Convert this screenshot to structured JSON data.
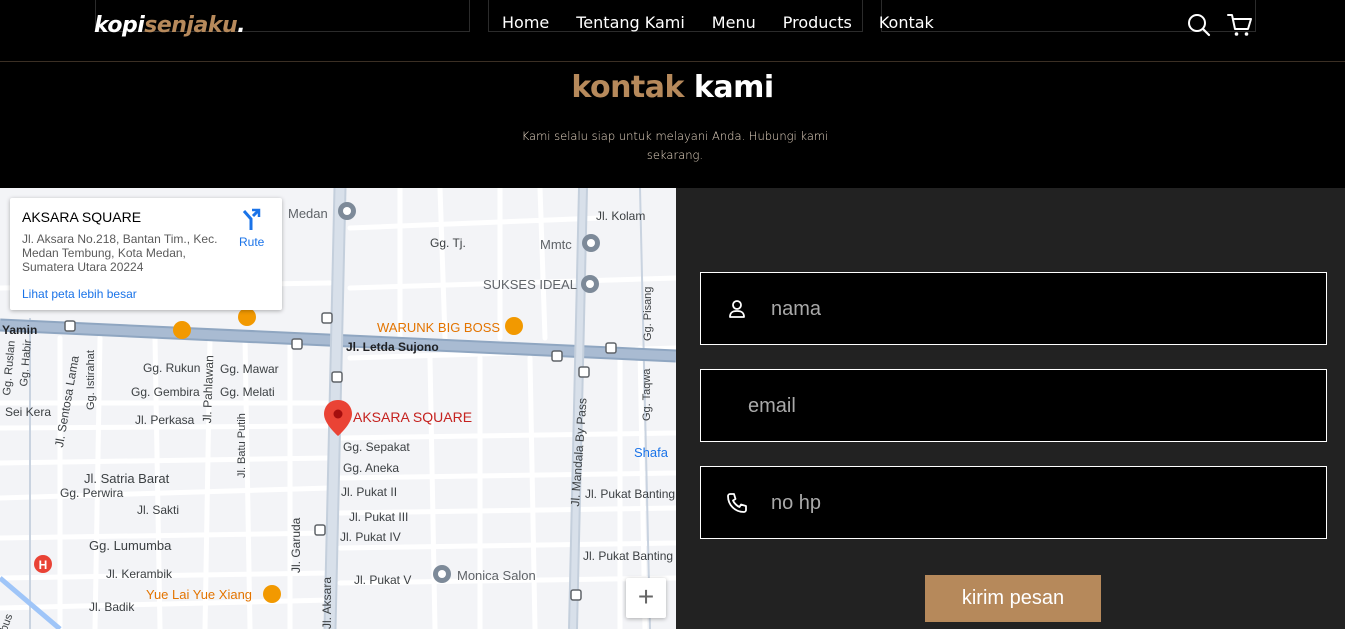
{
  "nav": {
    "logo_part1": "kopi",
    "logo_part2": "senjaku",
    "logo_part3": ".",
    "links": [
      "Home",
      "Tentang Kami",
      "Menu",
      "Products",
      "Kontak"
    ],
    "icons": [
      "search-icon",
      "shopping-cart-icon"
    ]
  },
  "section": {
    "title_accent": "kontak",
    "title_main": "kami",
    "subtitle": "Kami selalu siap untuk melayani Anda. Hubungi kami sekarang."
  },
  "map": {
    "place_card": {
      "name": "AKSARA SQUARE",
      "address": "Jl. Aksara No.218, Bantan Tim., Kec. Medan Tembung, Kota Medan, Sumatera Utara 20224",
      "larger_map_link": "Lihat peta lebih besar",
      "route_label": "Rute"
    },
    "labels": {
      "medan": "Medan",
      "jl_kolam": "Jl. Kolam",
      "gg_tj": "Gg. Tj.",
      "mmtc": "Mmtc",
      "sukses_ideal": "SUKSES IDEAL",
      "gg_pisang": "Gg. Pisang",
      "yamin": "Yamin",
      "warunk_big_boss": "WARUNK BIG BOSS",
      "jl_letda_sujono": "Jl. Letda Sujono",
      "gg_rukun": "Gg. Rukun",
      "gg_mawar": "Gg. Mawar",
      "gg_gembira": "Gg. Gembira",
      "gg_melati": "Gg. Melati",
      "sei_kera": "Sei Kera",
      "jl_perkasa": "Jl. Perkasa",
      "aksara_square_pin": "AKSARA SQUARE",
      "gg_sepakat": "Gg. Sepakat",
      "gg_aneka": "Gg. Aneka",
      "shafa": "Shafa",
      "jl_satria_barat": "Jl. Satria Barat",
      "gg_perwira": "Gg. Perwira",
      "jl_pukat_ii": "Jl. Pukat II",
      "jl_pukat_banting_1": "Jl. Pukat Banting",
      "jl_sakti": "Jl. Sakti",
      "jl_pukat_iii": "Jl. Pukat III",
      "jl_pukat_iv": "Jl. Pukat IV",
      "gg_lumumba": "Gg. Lumumba",
      "jl_pukat_banting_2": "Jl. Pukat Banting",
      "jl_kerambik": "Jl. Kerambik",
      "monica_salon": "Monica Salon",
      "jl_pukat_v": "Jl. Pukat V",
      "yue_lai": "Yue Lai Yue Xiang",
      "jl_badik": "Jl. Badik",
      "jl_sentosa_lama": "Jl. Sentosa Lama",
      "gg_istirahat": "Gg. Istirahat",
      "jl_pahlawan": "Jl. Pahlawan",
      "jl_batu_putih": "Jl. Batu Putih",
      "jl_garuda": "Jl. Garuda",
      "jl_aksara": "Jl. Aksara",
      "jl_mandala": "Jl. Mandala By Pass",
      "gg_taqwa": "Gg. Taqwa",
      "gg_ruslan": "Gg. Ruslan",
      "gg_habir": "Gg. Habir",
      "bus": "bus"
    },
    "zoom_in": "+"
  },
  "form": {
    "name_placeholder": "nama",
    "email_placeholder": "email",
    "phone_placeholder": "no hp",
    "submit_label": "kirim pesan"
  },
  "colors": {
    "accent": "#b6895b",
    "form_bg": "#222222",
    "page_bg": "#000000"
  }
}
